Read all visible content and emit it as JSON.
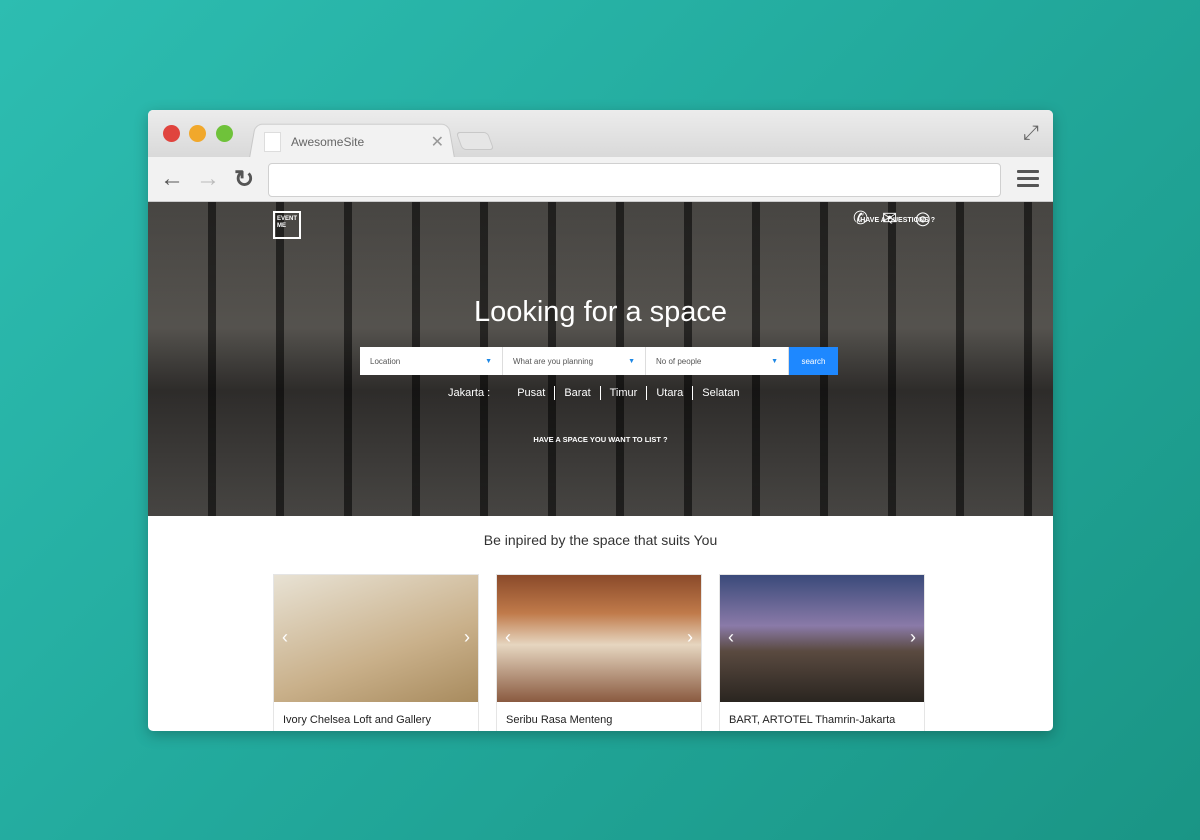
{
  "browser": {
    "tab_title": "AwesomeSite",
    "url": ""
  },
  "site": {
    "logo_text": "EVENT ME",
    "contact_label": "HAVE A QUESTIONS ?",
    "hero_title": "Looking for a space",
    "search": {
      "location": "Location",
      "planning": "What are you planning",
      "people": "No of people",
      "button": "search"
    },
    "areas_label": "Jakarta :",
    "areas": [
      "Pusat",
      "Barat",
      "Timur",
      "Utara",
      "Selatan"
    ],
    "list_cta": "HAVE A SPACE YOU WANT TO LIST ?",
    "section_title": "Be inpired by the space that suits You",
    "cards": [
      {
        "name": "Ivory Chelsea Loft and Gallery"
      },
      {
        "name": "Seribu Rasa Menteng"
      },
      {
        "name": "BART, ARTOTEL Thamrin-Jakarta"
      }
    ]
  },
  "colors": {
    "accent": "#1e88ff",
    "background": "#22a99c"
  }
}
